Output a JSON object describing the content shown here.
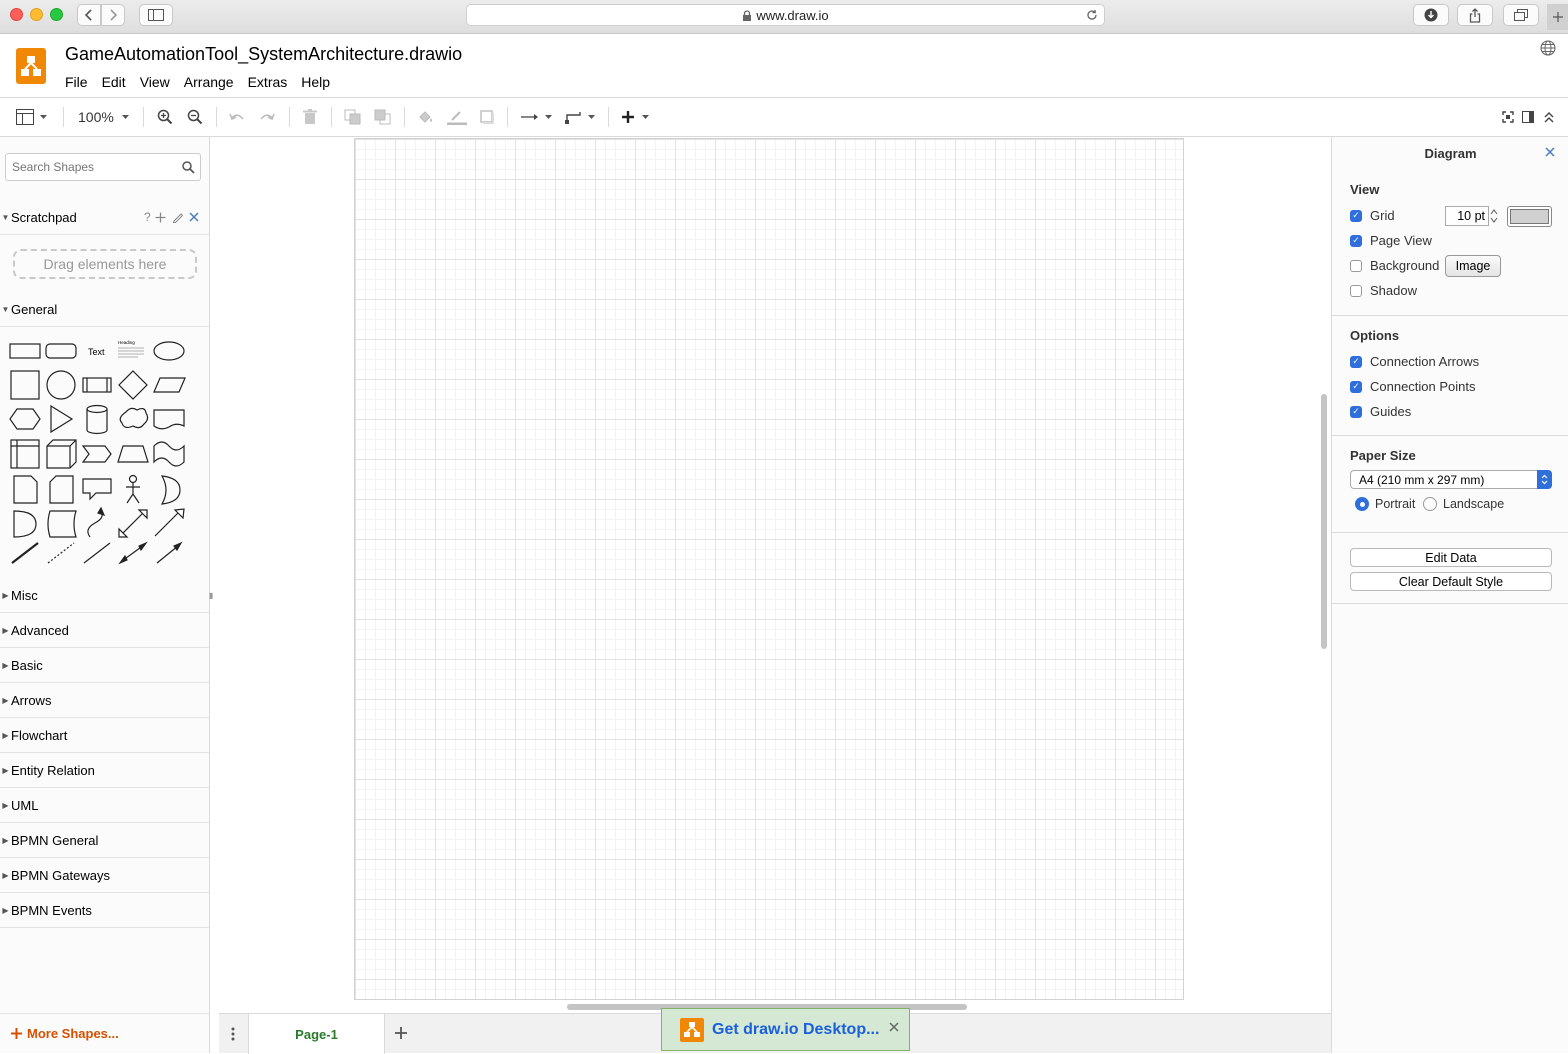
{
  "browser": {
    "url": "www.draw.io"
  },
  "app": {
    "document_title": "GameAutomationTool_SystemArchitecture.drawio",
    "menu": [
      "File",
      "Edit",
      "View",
      "Arrange",
      "Extras",
      "Help"
    ]
  },
  "toolbar": {
    "zoom": "100%"
  },
  "sidebar": {
    "search_placeholder": "Search Shapes",
    "scratchpad": {
      "title": "Scratchpad",
      "help": "?",
      "drop_hint": "Drag elements here"
    },
    "general": {
      "title": "General",
      "text_shape": "Text",
      "heading_shape": "Heading"
    },
    "sections": [
      "Misc",
      "Advanced",
      "Basic",
      "Arrows",
      "Flowchart",
      "Entity Relation",
      "UML",
      "BPMN General",
      "BPMN Gateways",
      "BPMN Events"
    ],
    "more_shapes": "More Shapes..."
  },
  "pages": {
    "tabs": [
      "Page-1"
    ],
    "active": "Page-1"
  },
  "banner": {
    "text": "Get draw.io Desktop..."
  },
  "format_panel": {
    "title": "Diagram",
    "view": {
      "label": "View",
      "grid": {
        "label": "Grid",
        "checked": true,
        "size": "10 pt"
      },
      "page_view": {
        "label": "Page View",
        "checked": true
      },
      "background": {
        "label": "Background",
        "checked": false,
        "button": "Image"
      },
      "shadow": {
        "label": "Shadow",
        "checked": false
      }
    },
    "options": {
      "label": "Options",
      "connection_arrows": {
        "label": "Connection Arrows",
        "checked": true
      },
      "connection_points": {
        "label": "Connection Points",
        "checked": true
      },
      "guides": {
        "label": "Guides",
        "checked": true
      }
    },
    "paper_size": {
      "label": "Paper Size",
      "selected": "A4 (210 mm x 297 mm)",
      "portrait": "Portrait",
      "landscape": "Landscape",
      "orientation": "Portrait"
    },
    "edit_data": "Edit Data",
    "clear_default_style": "Clear Default Style"
  },
  "colors": {
    "accent": "#2f6fdb",
    "drawio_orange": "#f08705",
    "more_shapes": "#d45100",
    "page_tab": "#2a7a2a",
    "banner_bg": "#d5e8d4"
  }
}
